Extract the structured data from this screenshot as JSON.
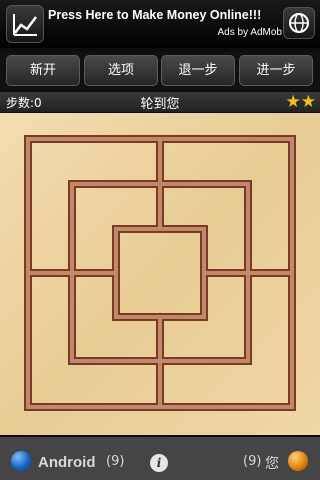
{
  "ad": {
    "headline": "Press Here to Make Money Online!!!",
    "attribution": "Ads by AdMob",
    "left_icon": "chart-line-icon",
    "right_icon": "globe-icon"
  },
  "toolbar": {
    "new_game": "新开",
    "options": "选项",
    "undo": "退一步",
    "redo": "进一步"
  },
  "status": {
    "steps": "步数:0",
    "turn": "轮到您",
    "stars": [
      "★",
      "★"
    ]
  },
  "board": {
    "type": "nine-mens-morris",
    "wood_color": "#eed6a3",
    "line_color": "#8f3f2a"
  },
  "players": {
    "p1": {
      "name": "Android",
      "count": "(9)",
      "color": "#1565c8"
    },
    "p2": {
      "name": "您",
      "count": "(9)",
      "color": "#e6820a"
    }
  },
  "info_symbol": "i"
}
